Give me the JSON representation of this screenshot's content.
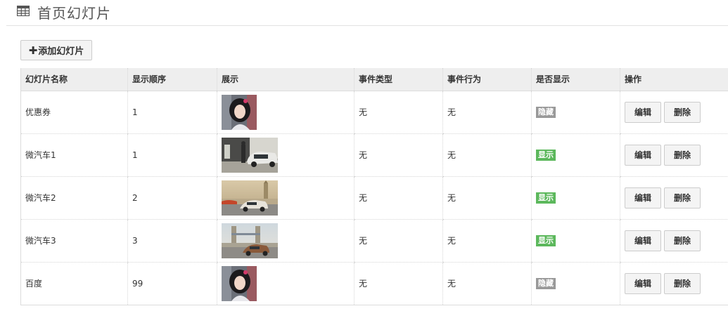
{
  "header": {
    "title": "首页幻灯片",
    "icon": "table-icon"
  },
  "toolbar": {
    "add_label": "添加幻灯片",
    "add_icon": "plus-icon"
  },
  "table": {
    "columns": [
      "幻灯片名称",
      "显示顺序",
      "展示",
      "事件类型",
      "事件行为",
      "是否显示",
      "操作"
    ],
    "rows": [
      {
        "name": "优惠券",
        "order": "1",
        "thumb": "portrait",
        "event_type": "无",
        "event_action": "无",
        "visible": "隐藏",
        "edit": "编辑",
        "delete": "删除"
      },
      {
        "name": "微汽车1",
        "order": "1",
        "thumb": "car-charging",
        "event_type": "无",
        "event_action": "无",
        "visible": "显示",
        "edit": "编辑",
        "delete": "删除"
      },
      {
        "name": "微汽车2",
        "order": "2",
        "thumb": "car-bigben",
        "event_type": "无",
        "event_action": "无",
        "visible": "显示",
        "edit": "编辑",
        "delete": "删除"
      },
      {
        "name": "微汽车3",
        "order": "3",
        "thumb": "car-bridge",
        "event_type": "无",
        "event_action": "无",
        "visible": "显示",
        "edit": "编辑",
        "delete": "删除"
      },
      {
        "name": "百度",
        "order": "99",
        "thumb": "portrait",
        "event_type": "无",
        "event_action": "无",
        "visible": "隐藏",
        "edit": "编辑",
        "delete": "删除"
      }
    ]
  },
  "colors": {
    "shown": "#5cb85c",
    "hidden": "#999999",
    "header_bg": "#eeeeee"
  }
}
